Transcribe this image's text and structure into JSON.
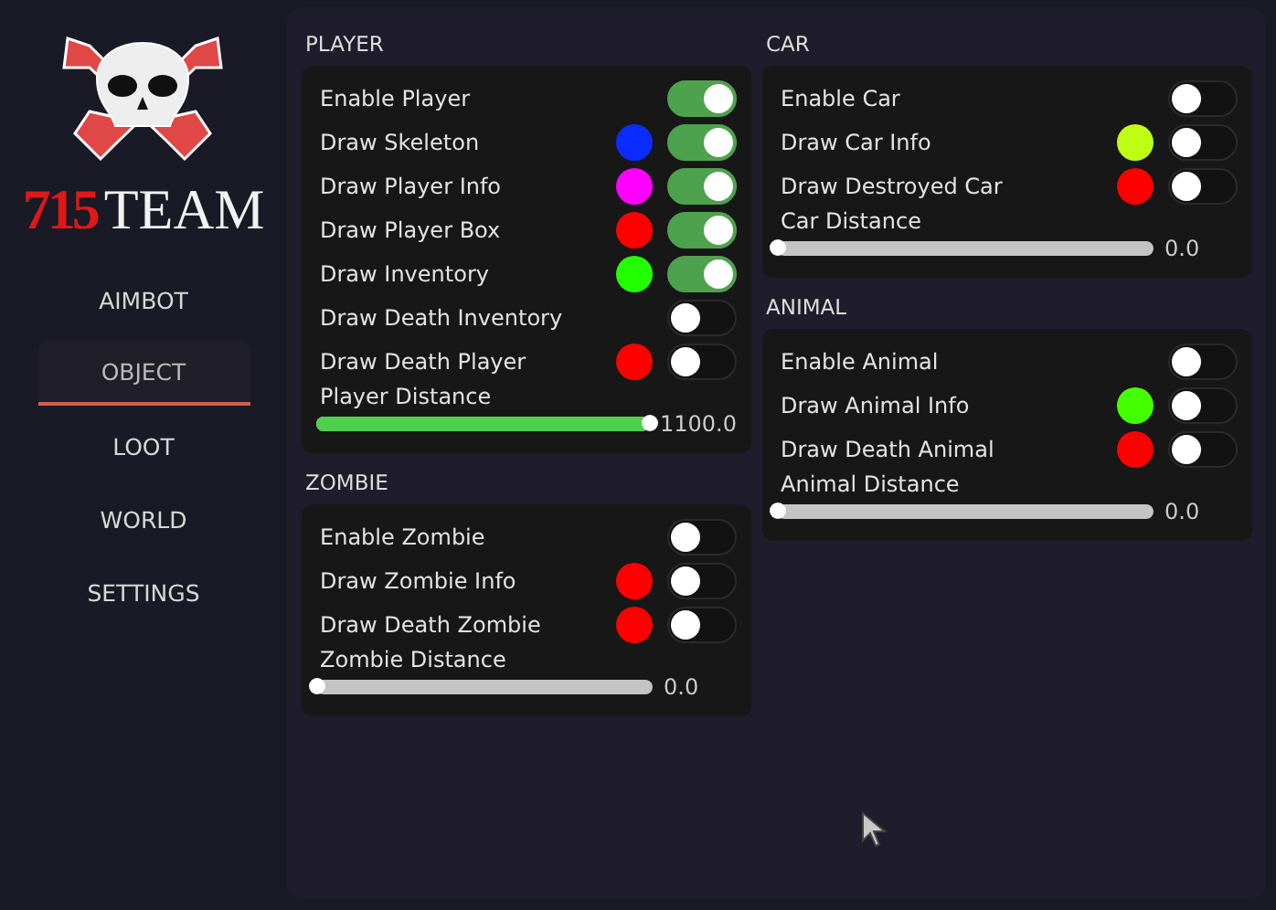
{
  "logo": {
    "number": "715",
    "word": "TEAM"
  },
  "nav": [
    {
      "label": "AIMBOT",
      "selected": false
    },
    {
      "label": "OBJECT",
      "selected": true
    },
    {
      "label": "LOOT",
      "selected": false
    },
    {
      "label": "WORLD",
      "selected": false
    },
    {
      "label": "SETTINGS",
      "selected": false
    }
  ],
  "columns": [
    [
      {
        "title": "PLAYER",
        "rows": [
          {
            "kind": "toggle",
            "label": "Enable Player",
            "on": true
          },
          {
            "kind": "toggle",
            "label": "Draw Skeleton",
            "on": true,
            "color": "#0a2cff"
          },
          {
            "kind": "toggle",
            "label": "Draw Player Info",
            "on": true,
            "color": "#ff00ff"
          },
          {
            "kind": "toggle",
            "label": "Draw Player Box",
            "on": true,
            "color": "#ff0000"
          },
          {
            "kind": "toggle",
            "label": "Draw Inventory",
            "on": true,
            "color": "#22ff00"
          },
          {
            "kind": "toggle",
            "label": "Draw Death Inventory",
            "on": false
          },
          {
            "kind": "toggle",
            "label": "Draw Death Player",
            "on": false,
            "color": "#ff0000"
          },
          {
            "kind": "slider",
            "label": "Player Distance",
            "level": 1,
            "reading": "1100.0"
          }
        ]
      },
      {
        "title": "ZOMBIE",
        "rows": [
          {
            "kind": "toggle",
            "label": "Enable Zombie",
            "on": false
          },
          {
            "kind": "toggle",
            "label": "Draw Zombie Info",
            "on": false,
            "color": "#ff0000"
          },
          {
            "kind": "toggle",
            "label": "Draw Death Zombie",
            "on": false,
            "color": "#ff0000"
          },
          {
            "kind": "slider",
            "label": "Zombie Distance",
            "level": 0,
            "reading": "0.0"
          }
        ]
      }
    ],
    [
      {
        "title": "CAR",
        "rows": [
          {
            "kind": "toggle",
            "label": "Enable Car",
            "on": false
          },
          {
            "kind": "toggle",
            "label": "Draw Car Info",
            "on": false,
            "color": "#bfff14"
          },
          {
            "kind": "toggle",
            "label": "Draw Destroyed Car",
            "on": false,
            "color": "#ff0000"
          },
          {
            "kind": "slider",
            "label": "Car Distance",
            "level": 0,
            "reading": "0.0"
          }
        ]
      },
      {
        "title": "ANIMAL",
        "rows": [
          {
            "kind": "toggle",
            "label": "Enable Animal",
            "on": false
          },
          {
            "kind": "toggle",
            "label": "Draw Animal Info",
            "on": false,
            "color": "#44ff00"
          },
          {
            "kind": "toggle",
            "label": "Draw Death Animal",
            "on": false,
            "color": "#ff0000"
          },
          {
            "kind": "slider",
            "label": "Animal Distance",
            "level": 0,
            "reading": "0.0"
          }
        ]
      }
    ]
  ]
}
